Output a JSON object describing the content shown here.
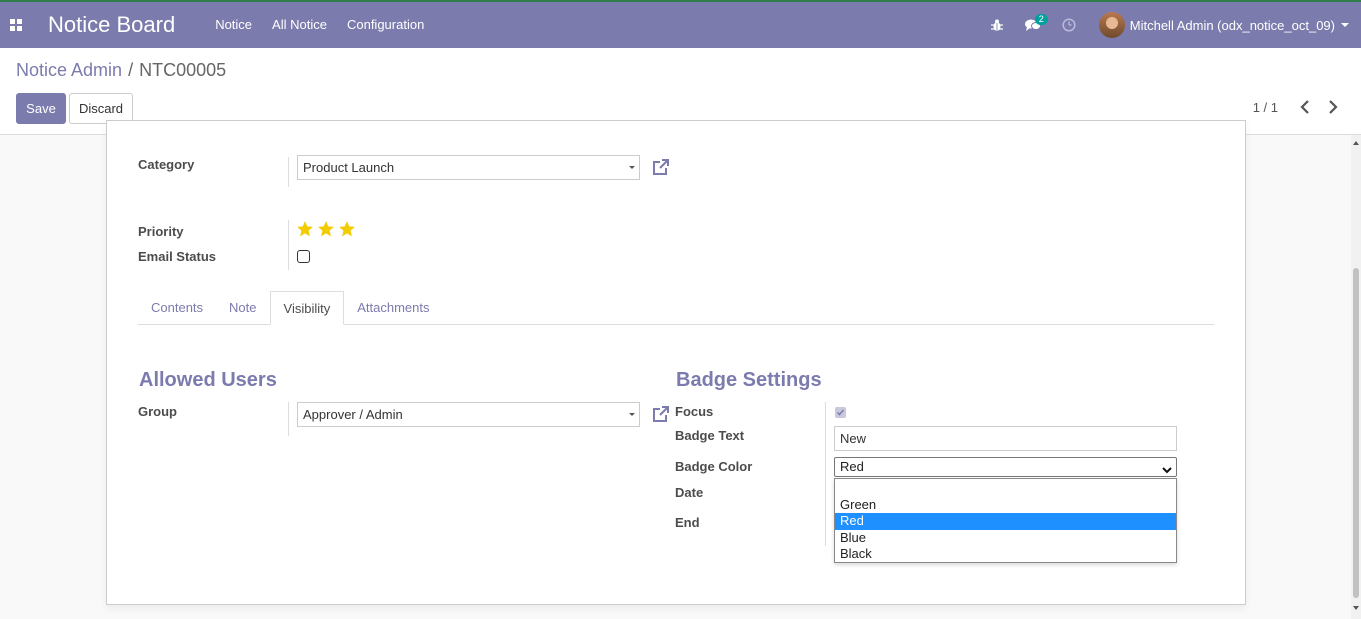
{
  "navbar": {
    "brand": "Notice Board",
    "menu": [
      "Notice",
      "All Notice",
      "Configuration"
    ],
    "messages_count": "2",
    "user_name": "Mitchell Admin (odx_notice_oct_09)"
  },
  "breadcrumb": {
    "parent": "Notice Admin",
    "separator": "/",
    "current": "NTC00005"
  },
  "buttons": {
    "save": "Save",
    "discard": "Discard"
  },
  "pager": {
    "value": "1 / 1"
  },
  "form": {
    "category_label": "Category",
    "category_value": "Product Launch",
    "priority_label": "Priority",
    "priority_value": 3,
    "priority_max": 3,
    "email_status_label": "Email Status",
    "email_status_checked": false
  },
  "tabs": [
    "Contents",
    "Note",
    "Visibility",
    "Attachments"
  ],
  "active_tab": "Visibility",
  "allowed_users": {
    "title": "Allowed Users",
    "group_label": "Group",
    "group_value": "Approver / Admin"
  },
  "badge_settings": {
    "title": "Badge Settings",
    "focus_label": "Focus",
    "focus_checked": true,
    "badge_text_label": "Badge Text",
    "badge_text_value": "New",
    "badge_color_label": "Badge Color",
    "badge_color_value": "Red",
    "date_label": "Date",
    "end_label": "End",
    "color_options": [
      "",
      "Green",
      "Red",
      "Blue",
      "Black"
    ],
    "selected_option": "Red"
  },
  "colors": {
    "primary": "#7c7bad",
    "star": "#f3cc00",
    "selected_option_bg": "#1e90ff",
    "messages_badge": "#00a09d"
  }
}
